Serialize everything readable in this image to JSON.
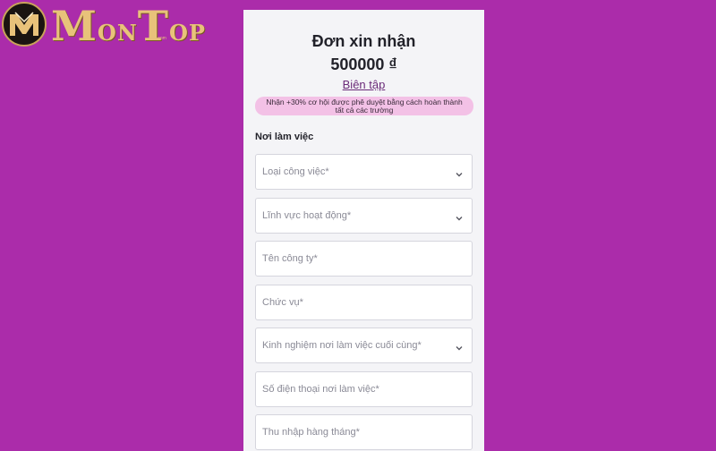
{
  "logo": {
    "text_big_1": "M",
    "text_small_1": "ON",
    "text_big_2": "T",
    "text_small_2": "OP",
    "sub": ".com"
  },
  "form": {
    "title": "Đơn xin nhận",
    "amount": "500000 ₫",
    "edit_label": "Biên tập",
    "promo": "Nhận +30% cơ hội được phê duyệt bằng cách hoàn thành tất cả các trường",
    "section": "Nơi làm việc",
    "fields": [
      {
        "placeholder": "Loại công việc*",
        "dropdown": true
      },
      {
        "placeholder": "Lĩnh vực hoạt động*",
        "dropdown": true
      },
      {
        "placeholder": "Tên công ty*",
        "dropdown": false
      },
      {
        "placeholder": "Chức vụ*",
        "dropdown": false
      },
      {
        "placeholder": "Kinh nghiệm nơi làm việc cuối cùng*",
        "dropdown": true
      },
      {
        "placeholder": "Số điện thoại nơi làm việc*",
        "dropdown": false
      },
      {
        "placeholder": "Thu nhập hàng tháng*",
        "dropdown": false
      }
    ]
  },
  "colors": {
    "background": "#ab2caa",
    "panel": "#f4f4f7",
    "promo": "#f3c1e6",
    "link": "#6a2a78",
    "logo_gold": "#e8c27a"
  }
}
